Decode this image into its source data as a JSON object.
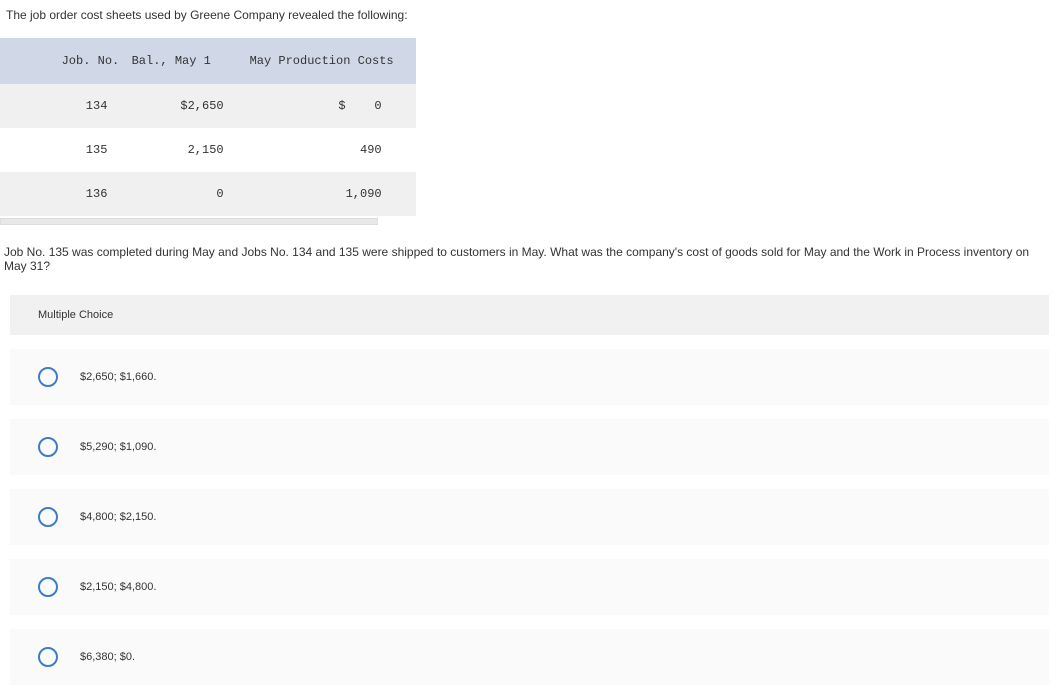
{
  "intro_text": "The job order cost sheets used by Greene Company revealed the following:",
  "table": {
    "headers": {
      "job_no": "Job. No.",
      "bal": "Bal., May 1",
      "prod": "May Production Costs"
    },
    "rows": [
      {
        "job_no": "134",
        "bal": "$2,650",
        "prod": "$    0"
      },
      {
        "job_no": "135",
        "bal": "2,150",
        "prod": "490"
      },
      {
        "job_no": "136",
        "bal": "0",
        "prod": "1,090"
      }
    ]
  },
  "question_text": "Job No. 135 was completed during May and Jobs No. 134 and 135 were shipped to customers in May. What was the company's cost of goods sold for May and the Work in Process inventory on May 31?",
  "mc_header": "Multiple Choice",
  "options": [
    {
      "label": "$2,650; $1,660."
    },
    {
      "label": "$5,290; $1,090."
    },
    {
      "label": "$4,800; $2,150."
    },
    {
      "label": "$2,150; $4,800."
    },
    {
      "label": "$6,380; $0."
    }
  ]
}
